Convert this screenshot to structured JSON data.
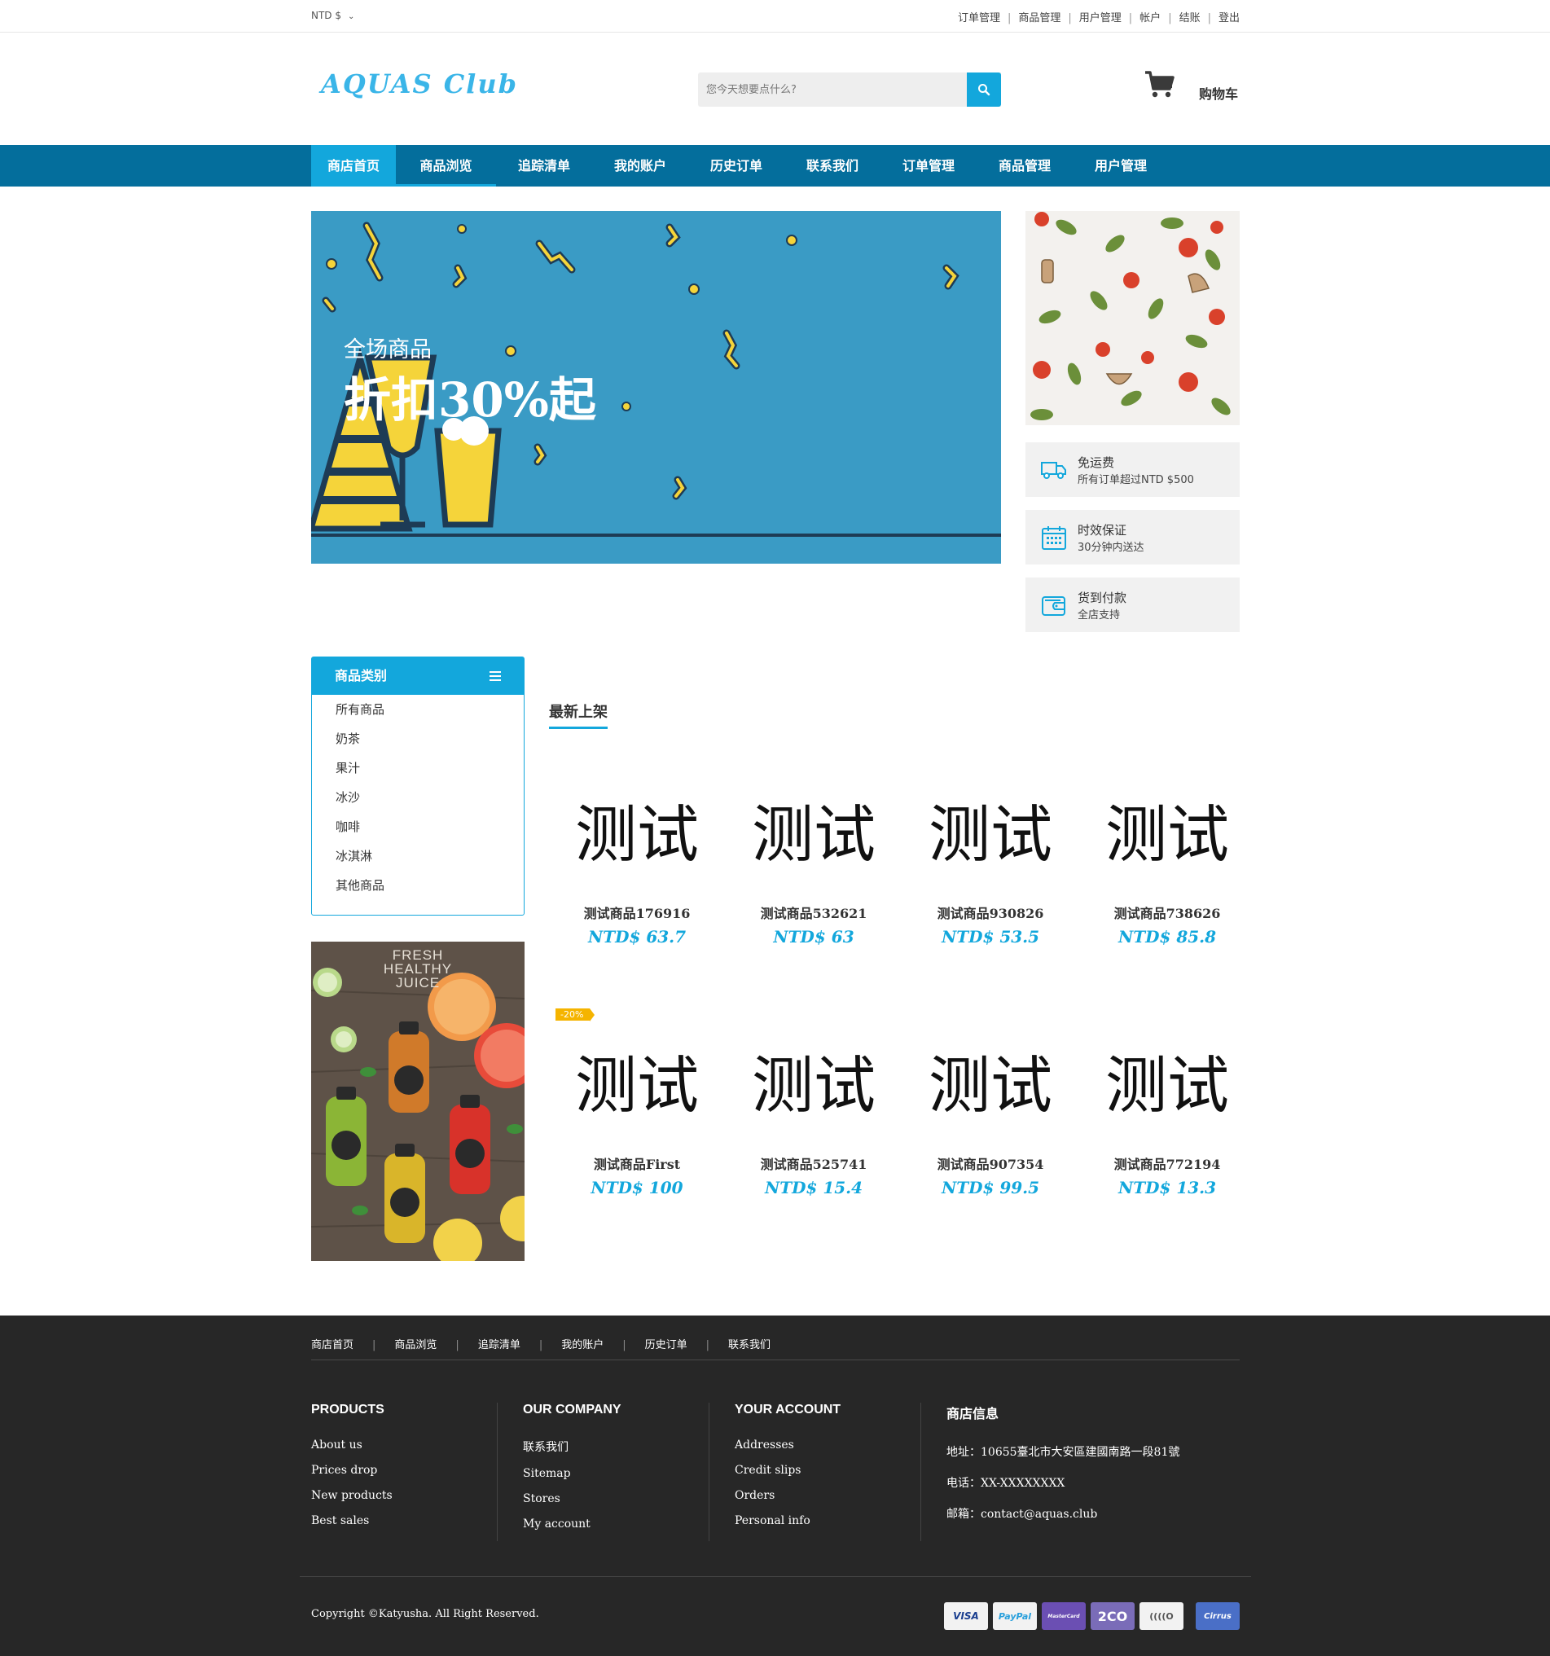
{
  "topbar": {
    "currency": "NTD $",
    "links": [
      "订单管理",
      "商品管理",
      "用户管理",
      "帐户",
      "结账",
      "登出"
    ]
  },
  "header": {
    "logo": "AQUAS Club",
    "search_placeholder": "您今天想要点什么?",
    "cart_label": "购物车"
  },
  "nav": {
    "items": [
      "商店首页",
      "商品浏览",
      "追踪清单",
      "我的账户",
      "历史订单",
      "联系我们",
      "订单管理",
      "商品管理",
      "用户管理"
    ]
  },
  "banner": {
    "subtitle": "全场商品",
    "title": "折扣30%起"
  },
  "features": [
    {
      "title": "免运费",
      "sub": "所有订单超过NTD $500",
      "icon": "truck-icon"
    },
    {
      "title": "时效保证",
      "sub": "30分钟内送达",
      "icon": "calendar-icon"
    },
    {
      "title": "货到付款",
      "sub": "全店支持",
      "icon": "wallet-icon"
    }
  ],
  "categories": {
    "title": "商品类别",
    "items": [
      "所有商品",
      "奶茶",
      "果汁",
      "冰沙",
      "咖啡",
      "冰淇淋",
      "其他商品"
    ]
  },
  "juice_ad": {
    "text": "FRESH HEALTHY JUICE",
    "line1": "FRESH",
    "line2": "HEALTHY",
    "line3": "JUICE"
  },
  "products": {
    "section_title": "最新上架",
    "items": [
      {
        "image_text": "测试",
        "name": "测试商品176916",
        "price": "NTD$ 63.7"
      },
      {
        "image_text": "测试",
        "name": "测试商品532621",
        "price": "NTD$ 63"
      },
      {
        "image_text": "测试",
        "name": "测试商品930826",
        "price": "NTD$ 53.5"
      },
      {
        "image_text": "测试",
        "name": "测试商品738626",
        "price": "NTD$ 85.8"
      },
      {
        "image_text": "测试",
        "name": "测试商品First",
        "price": "NTD$ 100",
        "badge": "-20%"
      },
      {
        "image_text": "测试",
        "name": "测试商品525741",
        "price": "NTD$ 15.4"
      },
      {
        "image_text": "测试",
        "name": "测试商品907354",
        "price": "NTD$ 99.5"
      },
      {
        "image_text": "测试",
        "name": "测试商品772194",
        "price": "NTD$ 13.3"
      }
    ]
  },
  "footer": {
    "nav": [
      "商店首页",
      "商品浏览",
      "追踪清单",
      "我的账户",
      "历史订单",
      "联系我们"
    ],
    "columns": [
      {
        "title": "PRODUCTS",
        "links": [
          "About us",
          "Prices drop",
          "New products",
          "Best sales"
        ]
      },
      {
        "title": "OUR COMPANY",
        "links": [
          "联系我们",
          "Sitemap",
          "Stores",
          "My account"
        ]
      },
      {
        "title": "YOUR ACCOUNT",
        "links": [
          "Addresses",
          "Credit slips",
          "Orders",
          "Personal info"
        ]
      },
      {
        "title": "商店信息",
        "links": [
          "地址：10655臺北市大安區建國南路一段81號",
          "电话：XX-XXXXXXXX",
          "邮箱：contact@aquas.club"
        ]
      }
    ],
    "copyright": "Copyright ©Katyusha. All Right Reserved.",
    "payments": [
      "VISA",
      "PayPal",
      "MasterCard",
      "2CO",
      "((((O",
      "Cirrus"
    ]
  },
  "colors": {
    "accent": "#13a7dc",
    "nav_bg": "#046e9c",
    "footer_bg": "#272727",
    "banner_bg": "#3a9bc5"
  }
}
